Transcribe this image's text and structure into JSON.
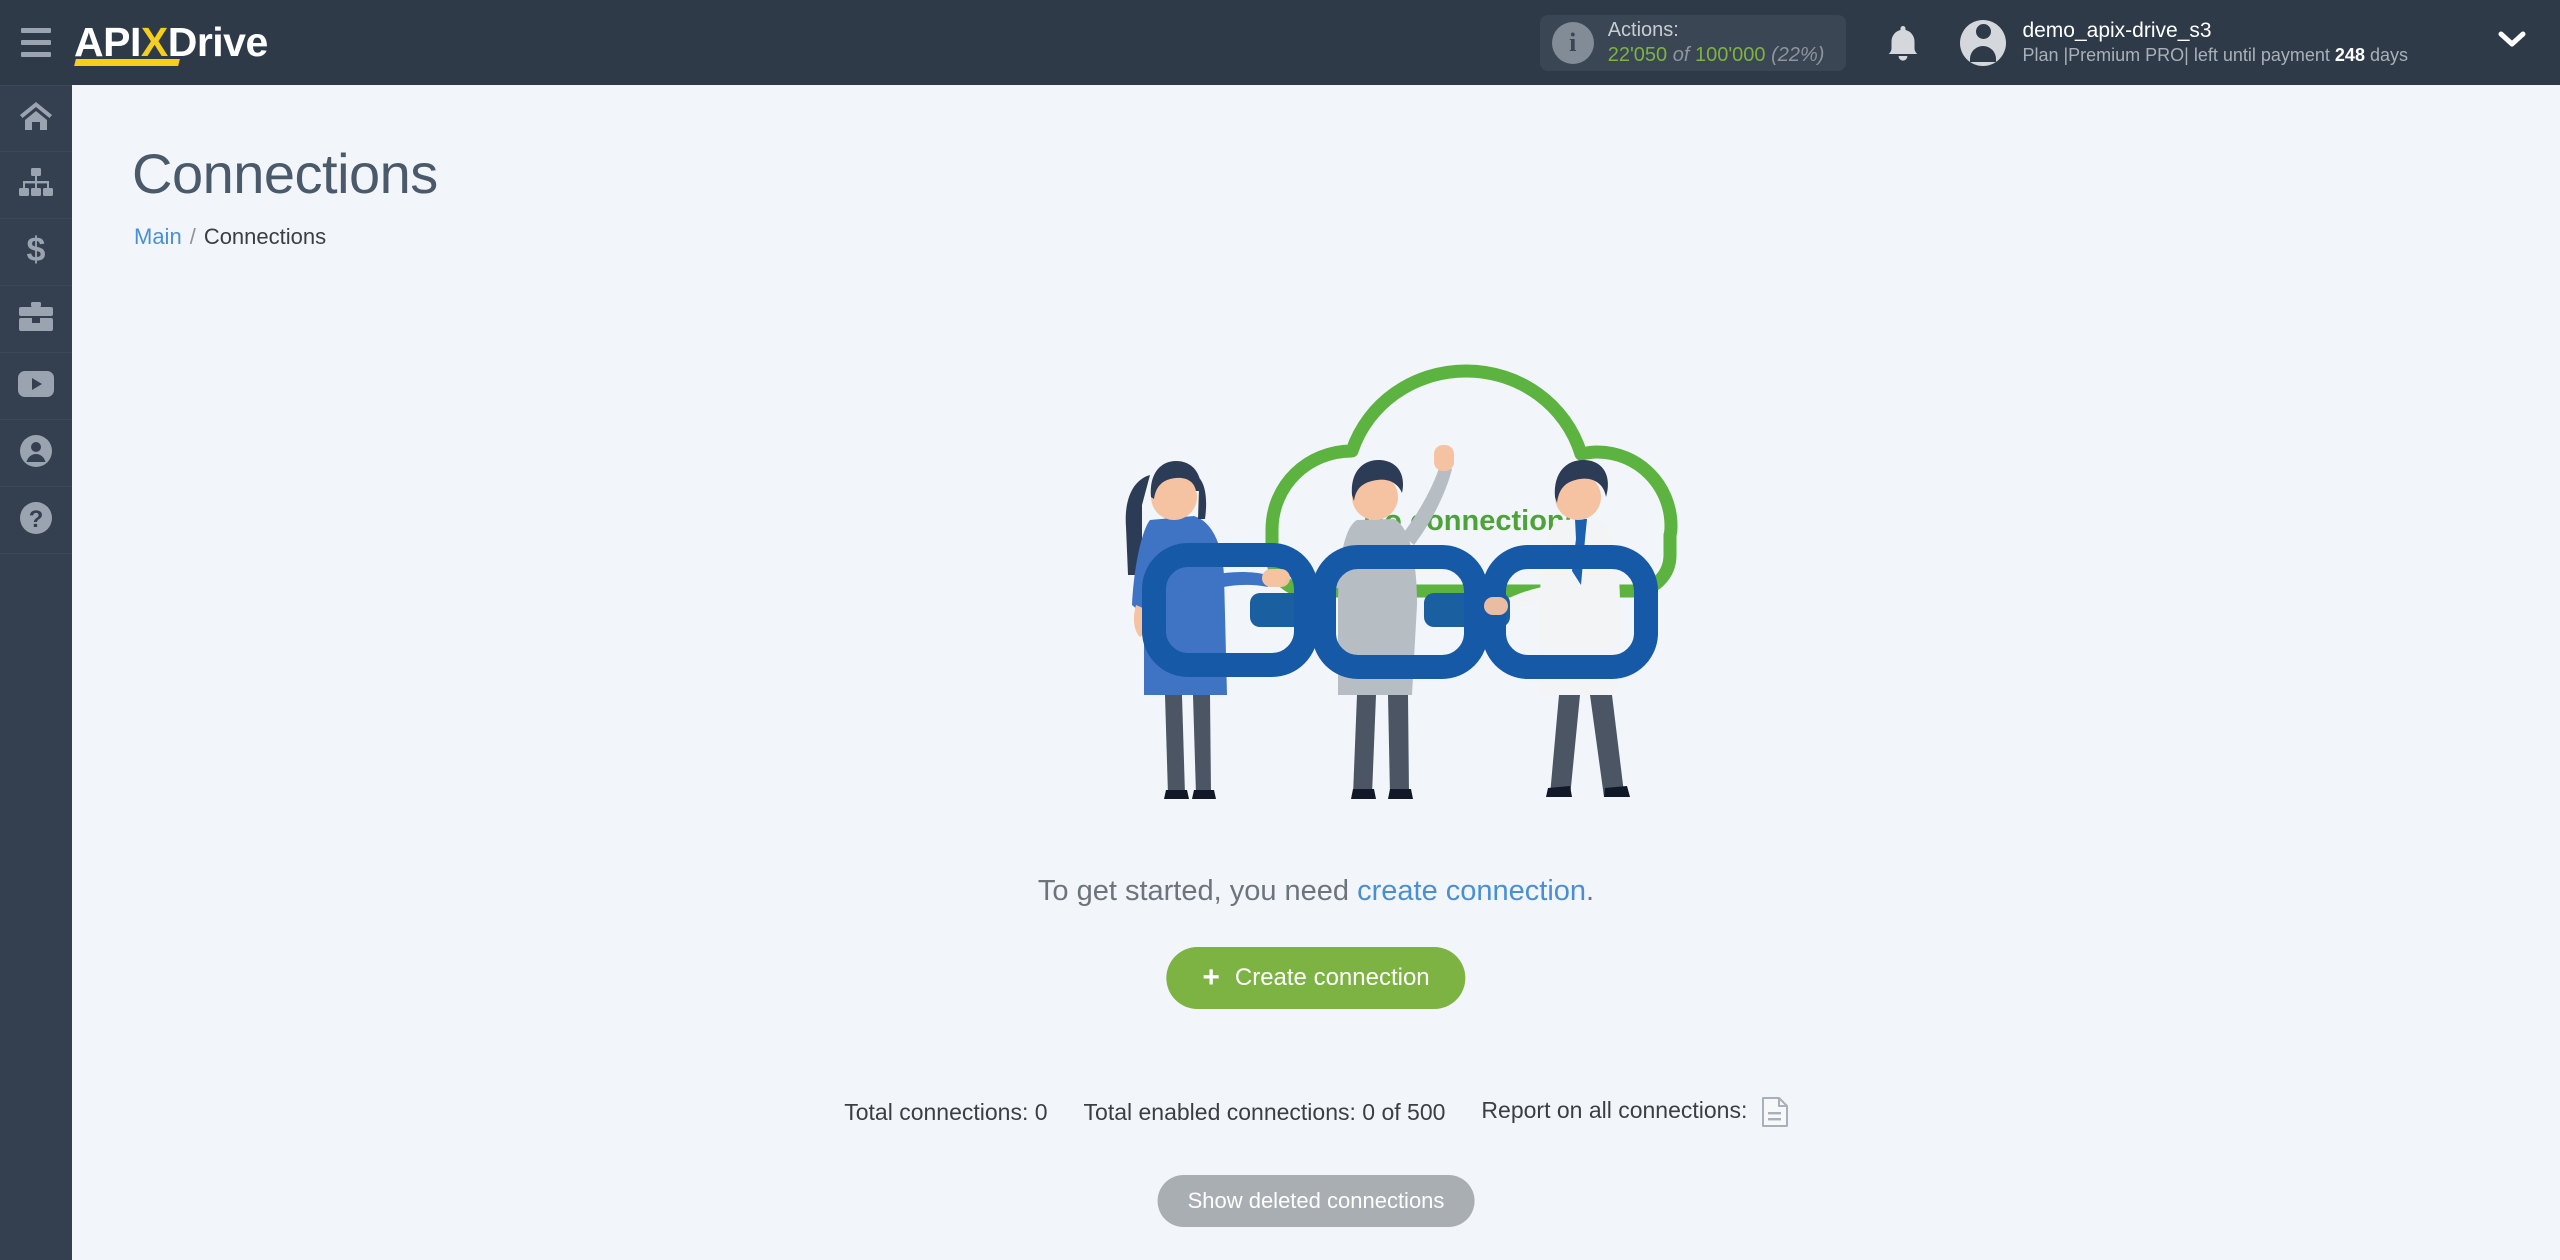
{
  "header": {
    "menu_icon": "hamburger-icon",
    "logo": {
      "part1": "API",
      "accent": "X",
      "part2": "Drive"
    },
    "actions": {
      "info_icon": "info-icon",
      "title": "Actions:",
      "used": "22'050",
      "of": "of",
      "total": "100'000",
      "percent": "(22%)"
    },
    "notifications_icon": "bell-icon",
    "user": {
      "avatar_icon": "user-avatar-icon",
      "name": "demo_apix-drive_s3",
      "plan_prefix": "Plan |Premium PRO| left until payment ",
      "days_value": "248",
      "plan_suffix": " days",
      "chevron_icon": "chevron-down-icon"
    }
  },
  "sidebar": {
    "items": [
      {
        "icon": "home-icon",
        "name": "sidebar-item-home"
      },
      {
        "icon": "sitemap-icon",
        "name": "sidebar-item-connections"
      },
      {
        "icon": "dollar-icon",
        "name": "sidebar-item-billing"
      },
      {
        "icon": "briefcase-icon",
        "name": "sidebar-item-services"
      },
      {
        "icon": "youtube-icon",
        "name": "sidebar-item-video"
      },
      {
        "icon": "user-icon",
        "name": "sidebar-item-profile"
      },
      {
        "icon": "question-icon",
        "name": "sidebar-item-help"
      }
    ]
  },
  "page": {
    "title": "Connections",
    "breadcrumb": {
      "root": "Main",
      "separator": "/",
      "current": "Connections"
    }
  },
  "illustration": {
    "cloud_label": "No connections",
    "cloud_color": "#5cb33f",
    "chain_color": "#1659a6"
  },
  "empty_state": {
    "text_before": "To get started, you need ",
    "link": "create connection",
    "text_after": ".",
    "create_button": {
      "icon": "plus-icon",
      "label": "Create connection",
      "color": "#7cb342"
    }
  },
  "stats": {
    "total_connections": "Total connections: 0",
    "total_enabled": "Total enabled connections: 0 of 500",
    "report_label": "Report on all connections:",
    "report_icon": "document-icon"
  },
  "footer": {
    "show_deleted_label": "Show deleted connections"
  }
}
